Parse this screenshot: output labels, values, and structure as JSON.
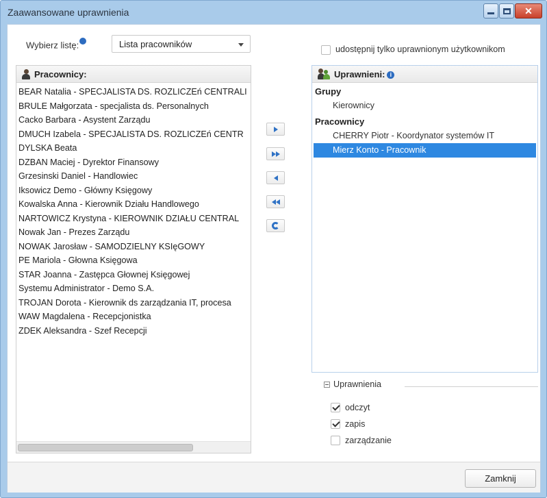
{
  "window": {
    "title": "Zaawansowane uprawnienia",
    "close_glyph": "✕"
  },
  "controls": {
    "choose_list_label": "Wybierz listę:",
    "choose_list_value": "Lista pracowników",
    "share_only_label": "udostępnij tylko uprawnionym użytkownikom",
    "share_only_checked": false
  },
  "left_panel": {
    "title": "Pracownicy:",
    "employees": [
      "BEAR Natalia - SPECJALISTA DS. ROZLICZEń CENTRALI",
      "BRULE Małgorzata - specjalista ds. Personalnych",
      "Cacko Barbara - Asystent Zarządu",
      "DMUCH Izabela - SPECJALISTA DS. ROZLICZEń CENTR",
      "DYLSKA Beata",
      "DZBAN Maciej - Dyrektor Finansowy",
      "Grzesinski Daniel - Handlowiec",
      "Iksowicz Demo - Główny Księgowy",
      "Kowalska Anna - Kierownik Działu Handlowego",
      "NARTOWICZ Krystyna - KIEROWNIK DZIAŁU CENTRAL",
      "Nowak Jan - Prezes Zarządu",
      "NOWAK Jarosław - SAMODZIELNY KSIęGOWY",
      "PE Mariola - Głowna Księgowa",
      "STAR Joanna - Zastępca Głownej Księgowej",
      "Systemu Administrator - Demo S.A.",
      "TROJAN Dorota - Kierownik ds zarządzania IT, procesa",
      "WAW Magdalena - Recepcjonistka",
      "ZDEK Aleksandra - Szef Recepcji"
    ]
  },
  "right_panel": {
    "title": "Uprawnieni:",
    "info_glyph": "i",
    "groups_title": "Grupy",
    "groups": [
      "Kierownicy"
    ],
    "employees_title": "Pracownicy",
    "employees": [
      {
        "label": "CHERRY Piotr - Koordynator systemów IT",
        "selected": false
      },
      {
        "label": "Mierz Konto - Pracownik",
        "selected": true
      }
    ]
  },
  "permissions": {
    "legend": "Uprawnienia",
    "items": [
      {
        "label": "odczyt",
        "checked": true
      },
      {
        "label": "zapis",
        "checked": true
      },
      {
        "label": "zarządzanie",
        "checked": false
      }
    ]
  },
  "footer": {
    "close_label": "Zamknij"
  },
  "colors": {
    "accent": "#2e88e1",
    "titlebar": "#a9cbea",
    "close_button": "#c8402a"
  }
}
